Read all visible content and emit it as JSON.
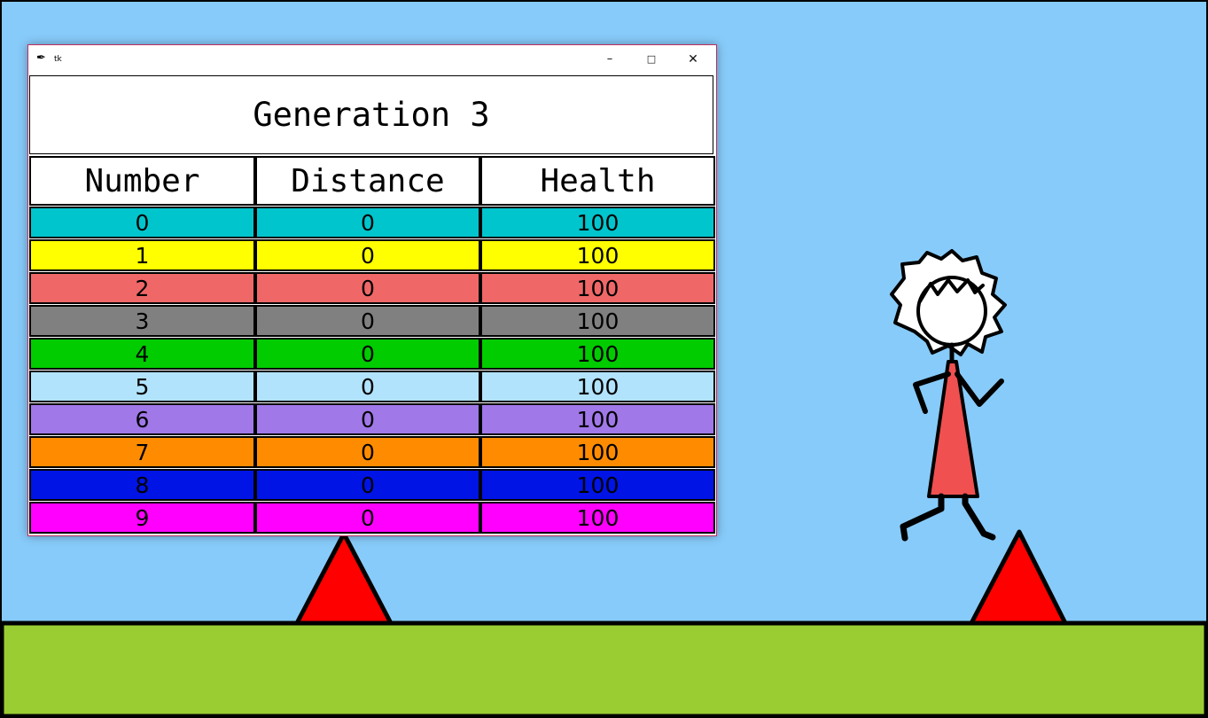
{
  "window": {
    "title": "tk",
    "controls": {
      "minimize": "–",
      "maximize": "□",
      "close": "✕"
    }
  },
  "generation_label": "Generation 3",
  "table": {
    "headers": [
      "Number",
      "Distance",
      "Health"
    ],
    "rows": [
      {
        "number": "0",
        "distance": "0",
        "health": "100",
        "color": "#00c5cd"
      },
      {
        "number": "1",
        "distance": "0",
        "health": "100",
        "color": "#ffff00"
      },
      {
        "number": "2",
        "distance": "0",
        "health": "100",
        "color": "#f06767"
      },
      {
        "number": "3",
        "distance": "0",
        "health": "100",
        "color": "#808080"
      },
      {
        "number": "4",
        "distance": "0",
        "health": "100",
        "color": "#00cc00"
      },
      {
        "number": "5",
        "distance": "0",
        "health": "100",
        "color": "#b2e3fc"
      },
      {
        "number": "6",
        "distance": "0",
        "health": "100",
        "color": "#a078e8"
      },
      {
        "number": "7",
        "distance": "0",
        "health": "100",
        "color": "#ff8c00"
      },
      {
        "number": "8",
        "distance": "0",
        "health": "100",
        "color": "#0014e6"
      },
      {
        "number": "9",
        "distance": "0",
        "health": "100",
        "color": "#ff00ff"
      }
    ]
  },
  "colors": {
    "sky": "#87cbfa",
    "ground": "#9acd32",
    "spike": "#ff0000",
    "dress": "#f05050",
    "outline": "#000000"
  }
}
